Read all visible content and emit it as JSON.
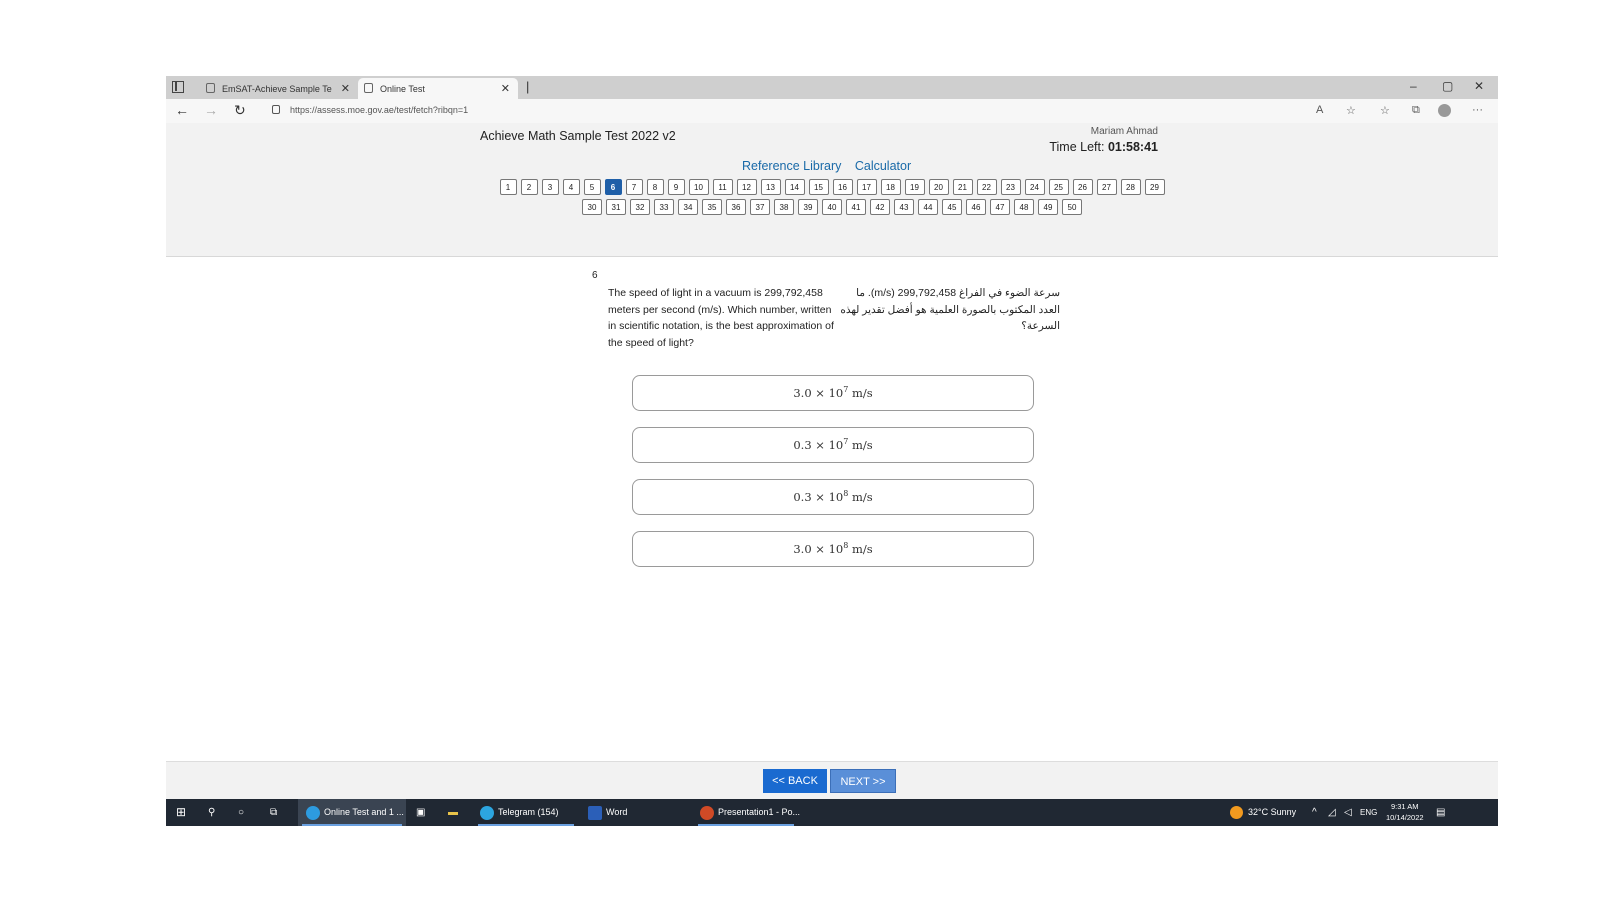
{
  "browser": {
    "tabs": [
      {
        "label": "EmSAT-Achieve Sample Test"
      },
      {
        "label": "Online Test"
      }
    ],
    "url": "https://assess.moe.gov.ae/test/fetch?ribqn=1"
  },
  "header": {
    "test_title": "Achieve Math Sample Test 2022 v2",
    "user_name": "Mariam Ahmad",
    "time_left_label": "Time Left:",
    "time_left_value": "01:58:41",
    "links": [
      "Reference Library",
      "Calculator"
    ]
  },
  "question_nav": {
    "current": "6",
    "row1": [
      "1",
      "2",
      "3",
      "4",
      "5",
      "6",
      "7",
      "8",
      "9",
      "10",
      "11",
      "12",
      "13",
      "14",
      "15",
      "16",
      "17",
      "18",
      "19",
      "20",
      "21",
      "22",
      "23",
      "24",
      "25",
      "26",
      "27",
      "28",
      "29"
    ],
    "row2": [
      "30",
      "31",
      "32",
      "33",
      "34",
      "35",
      "36",
      "37",
      "38",
      "39",
      "40",
      "41",
      "42",
      "43",
      "44",
      "45",
      "46",
      "47",
      "48",
      "49",
      "50"
    ]
  },
  "question": {
    "number": "6",
    "text_en": "The speed of light in a vacuum is 299,792,458 meters per second (m/s). Which number, written in scientific notation, is the best approximation of the speed of light?",
    "text_ar": "سرعة الضوء في الفراغ 299,792,458 (m/s). ما العدد المكتوب بالصورة العلمية هو أفضل تقدير لهذه السرعة؟",
    "choices": [
      {
        "mantissa": "3.0 × 10",
        "exponent": "7",
        "unit": " m/s"
      },
      {
        "mantissa": "0.3 × 10",
        "exponent": "7",
        "unit": " m/s"
      },
      {
        "mantissa": "0.3 × 10",
        "exponent": "8",
        "unit": " m/s"
      },
      {
        "mantissa": "3.0 × 10",
        "exponent": "8",
        "unit": " m/s"
      }
    ]
  },
  "footer": {
    "back_label": "<< BACK",
    "next_label": "NEXT >>"
  },
  "taskbar": {
    "apps": [
      {
        "label": "Online Test and 1 ..."
      },
      {
        "label": "Telegram (154)"
      },
      {
        "label": "Word"
      },
      {
        "label": "Presentation1 - Po..."
      }
    ],
    "weather": "32°C  Sunny",
    "language": "ENG",
    "time": "9:31 AM",
    "date": "10/14/2022"
  }
}
